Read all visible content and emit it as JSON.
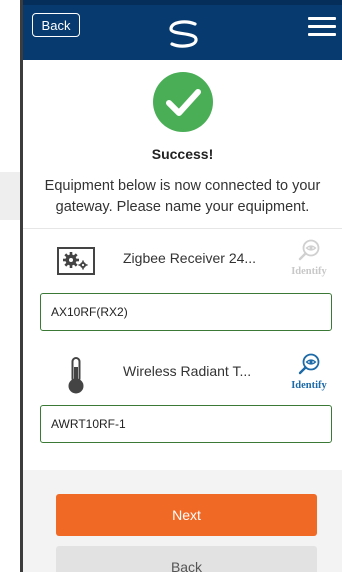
{
  "header": {
    "back_label": "Back",
    "logo_icon": "s-swoosh-logo-icon",
    "menu_icon": "hamburger-menu-icon"
  },
  "status": {
    "title": "Success!",
    "message": "Equipment below is now connected to your gateway. Please name your equipment."
  },
  "equipment": [
    {
      "name": "Zigbee Receiver 24...",
      "icon": "gear-box-icon",
      "identify_label": "Identify",
      "identify_enabled": false,
      "name_value": "AX10RF(RX2)"
    },
    {
      "name": "Wireless Radiant T...",
      "icon": "thermometer-icon",
      "identify_label": "Identify",
      "identify_enabled": true,
      "name_value": "AWRT10RF-1"
    }
  ],
  "actions": {
    "next_label": "Next",
    "back_label": "Back"
  },
  "colors": {
    "header": "#073a6e",
    "success": "#4aae57",
    "next": "#f06a26",
    "identify": "#1c6aa8"
  }
}
